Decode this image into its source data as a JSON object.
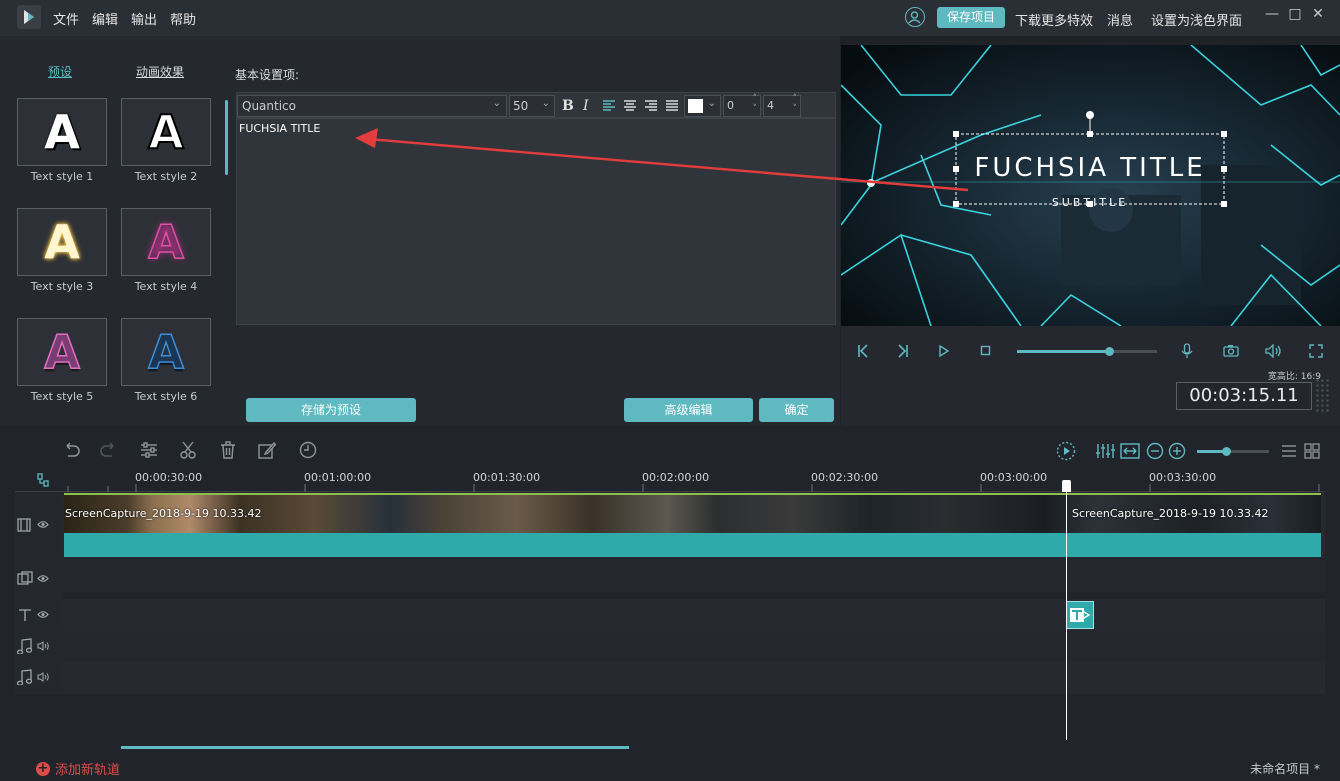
{
  "menu": [
    "文件",
    "编辑",
    "输出",
    "帮助"
  ],
  "topbar": {
    "save_project": "保存项目",
    "download_effects": "下载更多特效",
    "messages": "消息",
    "light_theme": "设置为浅色界面"
  },
  "left_panel": {
    "tabs": [
      "预设",
      "动画效果"
    ],
    "styles": [
      {
        "label": "Text style 1",
        "glyph": "A"
      },
      {
        "label": "Text style 2",
        "glyph": "A"
      },
      {
        "label": "Text style 3",
        "glyph": "A"
      },
      {
        "label": "Text style 4",
        "glyph": "A"
      },
      {
        "label": "Text style 5",
        "glyph": "A"
      },
      {
        "label": "Text style 6",
        "glyph": "A"
      }
    ]
  },
  "editor": {
    "heading": "基本设置项:",
    "font": "Quantico",
    "font_size": "50",
    "bold": "B",
    "italic": "I",
    "spacing_a": "0",
    "spacing_b": "4",
    "text": "FUCHSIA TITLE",
    "save_preset": "存储为预设",
    "advanced": "高级编辑",
    "ok": "确定"
  },
  "preview": {
    "title": "FUCHSIA TITLE",
    "subtitle": "SUBTITLE"
  },
  "player": {
    "aspect_label": "宽高比:",
    "aspect_value": "16:9",
    "timecode": "00:03:15.11",
    "volume_percent": 66
  },
  "timeline": {
    "ruler": [
      "00:00:30:00",
      "00:01:00:00",
      "00:01:30:00",
      "00:02:00:00",
      "00:02:30:00",
      "00:03:00:00",
      "00:03:30:00"
    ],
    "clip1_name": "ScreenCapture_2018-9-19 10.33.42",
    "clip2_name": "ScreenCapture_2018-9-19 10.33.42",
    "add_track": "添加新轨道",
    "project_name": "未命名项目 *",
    "zoom_percent": 40
  },
  "colors": {
    "accent": "#5fb9c1",
    "background": "#1f2227",
    "panel": "#25292f",
    "arrow": "#e23c3c",
    "title_track": "#2fa9a9"
  }
}
